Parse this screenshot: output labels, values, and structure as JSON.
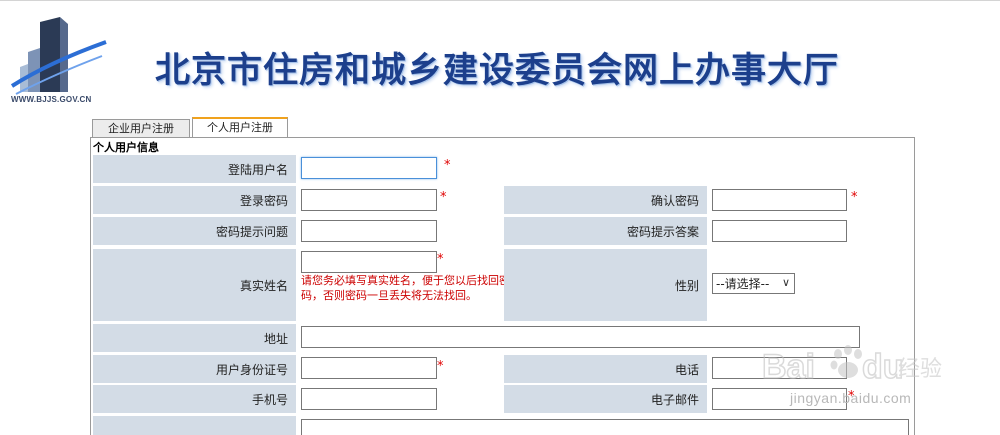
{
  "header": {
    "logo_url_text": "WWW.BJJS.GOV.CN",
    "title": "北京市住房和城乡建设委员会网上办事大厅"
  },
  "tabs": [
    {
      "label": "企业用户注册",
      "active": false
    },
    {
      "label": "个人用户注册",
      "active": true
    }
  ],
  "form": {
    "section_title": "个人用户信息",
    "required_mark": "*",
    "labels": {
      "username": "登陆用户名",
      "password": "登录密码",
      "confirm_password": "确认密码",
      "hint_question": "密码提示问题",
      "hint_answer": "密码提示答案",
      "real_name": "真实姓名",
      "gender": "性别",
      "address": "地址",
      "id_number": "用户身份证号",
      "phone": "电话",
      "mobile": "手机号",
      "email": "电子邮件"
    },
    "values": {
      "username": "",
      "password": "",
      "confirm_password": "",
      "hint_question": "",
      "hint_answer": "",
      "real_name": "",
      "address": "",
      "id_number": "",
      "phone": "",
      "mobile": "",
      "email": ""
    },
    "real_name_hint": "请您务必填写真实姓名，便于您以后找回密码，否则密码一旦丢失将无法找回。",
    "gender_selected": "--请选择--"
  },
  "watermark": {
    "text": "jingyan.baidu.com",
    "brand": "Baidu 经验"
  },
  "colors": {
    "label_bg": "#d3dce6",
    "title_blue": "#1c3f8c",
    "required_red": "#e00000",
    "active_tab_accent": "#f0a21d"
  }
}
